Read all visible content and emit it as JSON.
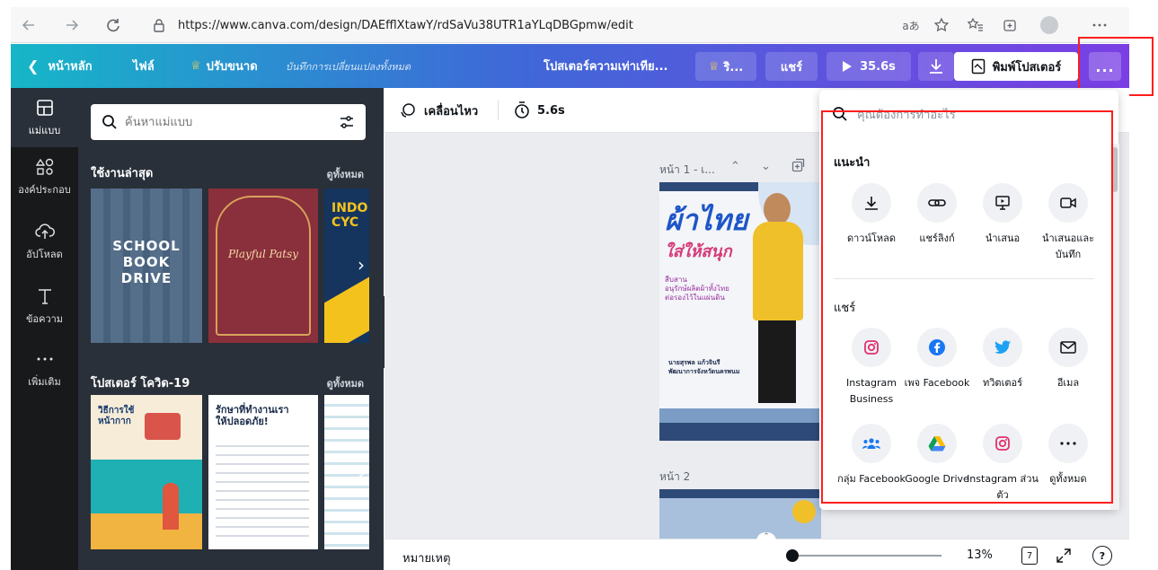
{
  "browser": {
    "url": "https://www.canva.com/design/DAEfflXtawY/rdSaVu38UTR1aYLqDBGpmw/edit",
    "read_aloud": "aあ"
  },
  "header": {
    "home": "หน้าหลัก",
    "file": "ไฟล์",
    "resize": "ปรับขนาด",
    "saved_status": "บันทึกการเปลี่ยนแปลงทั้งหมด",
    "title": "โปสเตอร์ความเท่าเทีย...",
    "crown_btn": "ริ...",
    "share": "แชร์",
    "present_time": "35.6s",
    "print": "พิมพ์โปสเตอร์",
    "more": "..."
  },
  "rail": [
    {
      "label": "แม่แบบ",
      "icon": "layout-icon"
    },
    {
      "label": "องค์ประกอบ",
      "icon": "shapes-icon"
    },
    {
      "label": "อัปโหลด",
      "icon": "cloud-upload-icon"
    },
    {
      "label": "ข้อความ",
      "icon": "text-icon"
    },
    {
      "label": "เพิ่มเติม",
      "icon": "dots-icon"
    }
  ],
  "panel": {
    "search_placeholder": "ค้นหาแม่แบบ",
    "recent_title": "ใช้งานล่าสุด",
    "see_all": "ดูทั้งหมด",
    "covid_title": "โปสเตอร์ โควิด-19",
    "see_all_2": "ดูทั้งหมด",
    "recent_thumbs": [
      {
        "l1": "SCHOOL",
        "l2": "BOOK",
        "l3": "DRIVE"
      },
      {
        "l1": "Playful Patsy"
      },
      {
        "l1": "INDO",
        "l2": "CYC"
      }
    ],
    "covid_thumbs": [
      {
        "l1": "วิธีการใช้",
        "l2": "หน้ากาก"
      },
      {
        "l1": "รักษาที่ทำงานเรา",
        "l2": "ให้ปลอดภัย!"
      }
    ]
  },
  "toolbar": {
    "animate": "เคลื่อนไหว",
    "timing": "5.6s"
  },
  "canvas": {
    "page1_label": "หน้า 1 - เ...",
    "page2_label": "หน้า 2",
    "poster": {
      "headline1": "ผ้าไทย",
      "headline2": "ใส่ให้สนุก",
      "sub1": "สืบสาน",
      "sub2": "อนุรักษ์ผลิตผ้าทั้งไทย",
      "sub3": "ต่อรองไว้ในแผ่นดิน",
      "name": "นายสุรพล แก้วจินรี",
      "role": "พัฒนาการจังหวัดนครพนม"
    }
  },
  "footer": {
    "notes": "หมายเหตุ",
    "zoom": "13%",
    "pages": "7",
    "help": "?"
  },
  "dropdown": {
    "search_placeholder": "คุณต้องการทำอะไร",
    "suggested_heading": "แนะนำ",
    "suggested": [
      {
        "label": "ดาวน์โหลด",
        "icon": "download-icon"
      },
      {
        "label": "แชร์ลิงก์",
        "icon": "link-icon"
      },
      {
        "label": "นำเสนอ",
        "icon": "present-icon"
      },
      {
        "label": "นำเสนอและบันทึก",
        "icon": "record-icon"
      }
    ],
    "share_heading": "แชร์",
    "share": [
      {
        "label": "Instagram Business",
        "icon": "instagram-icon"
      },
      {
        "label": "เพจ Facebook",
        "icon": "facebook-icon"
      },
      {
        "label": "ทวิตเตอร์",
        "icon": "twitter-icon"
      },
      {
        "label": "อีเมล",
        "icon": "email-icon"
      },
      {
        "label": "กลุ่ม Facebook",
        "icon": "facebook-group-icon"
      },
      {
        "label": "Google Drive",
        "icon": "google-drive-icon"
      },
      {
        "label": "Instagram ส่วนตัว",
        "icon": "instagram-personal-icon"
      },
      {
        "label": "ดูทั้งหมด",
        "icon": "more-dots-icon"
      }
    ]
  },
  "colors": {
    "header_start": "#16b6c8",
    "header_end": "#7b3fe4",
    "rail_bg": "#18191b",
    "panel_bg": "#293039",
    "highlight": "#ff1e1e"
  }
}
